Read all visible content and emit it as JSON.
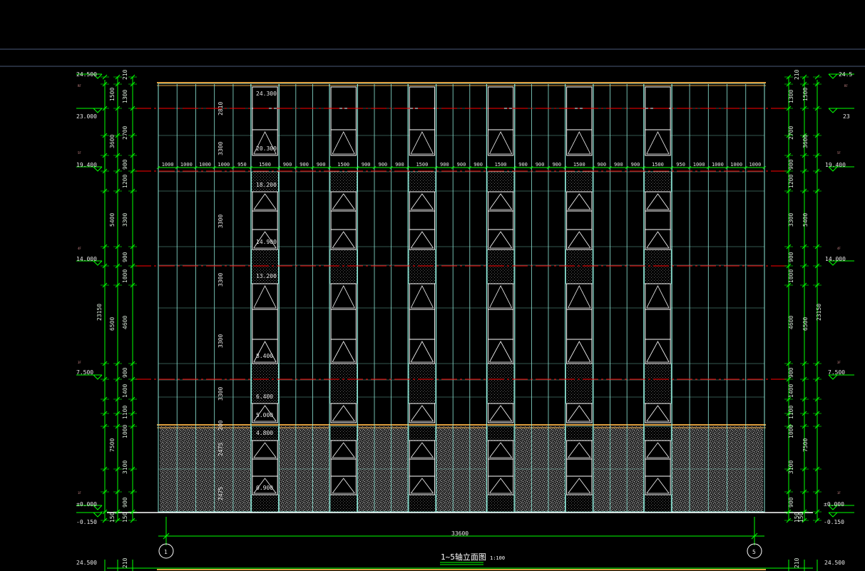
{
  "drawing": {
    "title": "1~5轴立面图",
    "scale": "1:100",
    "total_width": "33600",
    "axis_left": "1",
    "axis_right": "5"
  },
  "left_elevations": {
    "top": "24.500",
    "second": "23.000",
    "third": "19.400",
    "fourth": "14.000",
    "fifth": "7.500",
    "ground": "±0.000",
    "below": "-0.150"
  },
  "right_elevations": {
    "top": "24.5",
    "second": "23",
    "third": "19.400",
    "fourth": "14.000",
    "fifth": "7.500",
    "ground": "±0.000",
    "below": "-0.150"
  },
  "bottom_elevations": {
    "left": "24.500",
    "right": "24.500"
  },
  "inner_dims_left": [
    "210",
    "1300",
    "2700",
    "900",
    "1200",
    "3300",
    "900",
    "1000",
    "4600",
    "900",
    "1400",
    "1100",
    "1000",
    "3100",
    "900",
    "150"
  ],
  "mid_dims_left": [
    "1500",
    "3600",
    "5400",
    "6500",
    "7500",
    "150"
  ],
  "outer_dim_left": "23150",
  "inner_dims_right": [
    "210",
    "1300",
    "2700",
    "900",
    "1200",
    "3300",
    "900",
    "1000",
    "4600",
    "900",
    "1400",
    "1100",
    "1000",
    "3100",
    "900",
    "150"
  ],
  "mid_dims_right": [
    "1500",
    "3600",
    "5400",
    "6500",
    "7500",
    "150"
  ],
  "outer_dim_right": "23150",
  "facade_vertical_dims": [
    "2810",
    "3300",
    "3300",
    "3300",
    "3300",
    "200",
    "2475",
    "2475"
  ],
  "bay_dims": [
    "1000",
    "1000",
    "1000",
    "1000",
    "950",
    "1500",
    "900",
    "900",
    "900",
    "1500",
    "900",
    "900",
    "900",
    "1500",
    "900",
    "900",
    "900",
    "1500",
    "900",
    "900",
    "900",
    "1500",
    "900",
    "900",
    "900",
    "1500",
    "950",
    "1000",
    "1000",
    "1000",
    "1000"
  ],
  "window_elevations": {
    "e24300": "24.300",
    "e20300": "20.300",
    "e18200": "18.200",
    "e14900": "14.900",
    "e13200": "13.200",
    "e8400": "8.400",
    "e6400": "6.400",
    "e5000": "5.000",
    "e4800": "4.800",
    "e0900": "0.900"
  },
  "floor_tags": {
    "rf": "RF",
    "f5": "5F",
    "f4": "4F",
    "f3": "3F",
    "f2": "2F",
    "f1": "1F"
  },
  "colors": {
    "background": "#000000",
    "green": "#00ff00",
    "red": "#ff0000",
    "cyan": "#8ee8d8",
    "white": "#ffffff",
    "orange": "#e0a040",
    "stone": "#aaaaaa"
  }
}
